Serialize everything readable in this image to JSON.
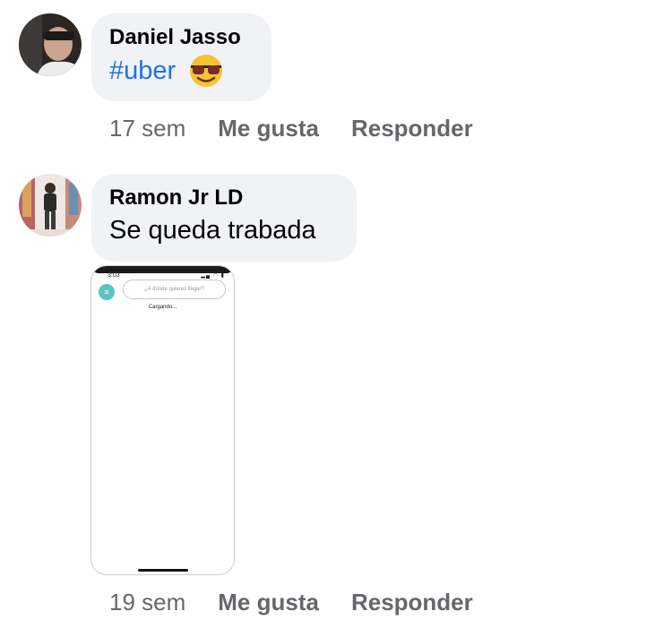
{
  "comments": [
    {
      "author": "Daniel Jasso",
      "hashtag": "#uber",
      "emoji": "smiling-face-with-sunglasses-icon",
      "time": "17 sem",
      "like_label": "Me gusta",
      "reply_label": "Responder"
    },
    {
      "author": "Ramon Jr LD",
      "text": "Se queda trabada",
      "time": "19 sem",
      "like_label": "Me gusta",
      "reply_label": "Responder",
      "attachment": {
        "status_time": "3:03",
        "status_icons": "signal-wifi-battery-icons",
        "search_placeholder": "¿A dónde quieres llegar?",
        "loading_text": "Cargando..."
      }
    }
  ],
  "colors": {
    "bubble": "#f0f2f5",
    "hashtag": "#1b74e4",
    "meta_text": "#65676b",
    "menu_button": "#5bc4c0"
  }
}
